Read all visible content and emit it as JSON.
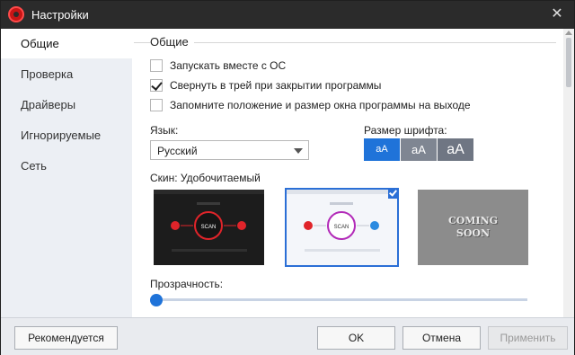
{
  "window": {
    "title": "Настройки"
  },
  "sidebar": {
    "items": [
      {
        "label": "Общие",
        "active": true
      },
      {
        "label": "Проверка"
      },
      {
        "label": "Драйверы"
      },
      {
        "label": "Игнорируемые"
      },
      {
        "label": "Сеть"
      }
    ]
  },
  "general": {
    "section_title": "Общие",
    "options": [
      {
        "label": "Запускать вместе с ОС",
        "checked": false
      },
      {
        "label": "Свернуть в трей при закрытии программы",
        "checked": true
      },
      {
        "label": "Запомните положение и размер окна программы на выходе",
        "checked": false
      }
    ],
    "language_label": "Язык:",
    "language_value": "Русский",
    "font_size_label": "Размер шрифта:",
    "font_sizes": [
      "aA",
      "aA",
      "aA"
    ],
    "font_size_selected": 0,
    "skin_label": "Скин: Удобочитаемый",
    "skins": [
      {
        "name": "dark",
        "selected": false,
        "scan_label": "SCAN"
      },
      {
        "name": "light",
        "selected": true,
        "scan_label": "SCAN"
      },
      {
        "name": "coming-soon",
        "text_line1": "COMING",
        "text_line2": "SOON"
      }
    ],
    "transparency_label": "Прозрачность:",
    "transparency_value": 0
  },
  "footer": {
    "recommend_label": "Рекомендуется",
    "ok_label": "OK",
    "cancel_label": "Отмена",
    "apply_label": "Применить"
  },
  "colors": {
    "accent": "#1f73d9",
    "titlebar": "#2b2b2b",
    "sidebar_bg": "#eceff4"
  }
}
